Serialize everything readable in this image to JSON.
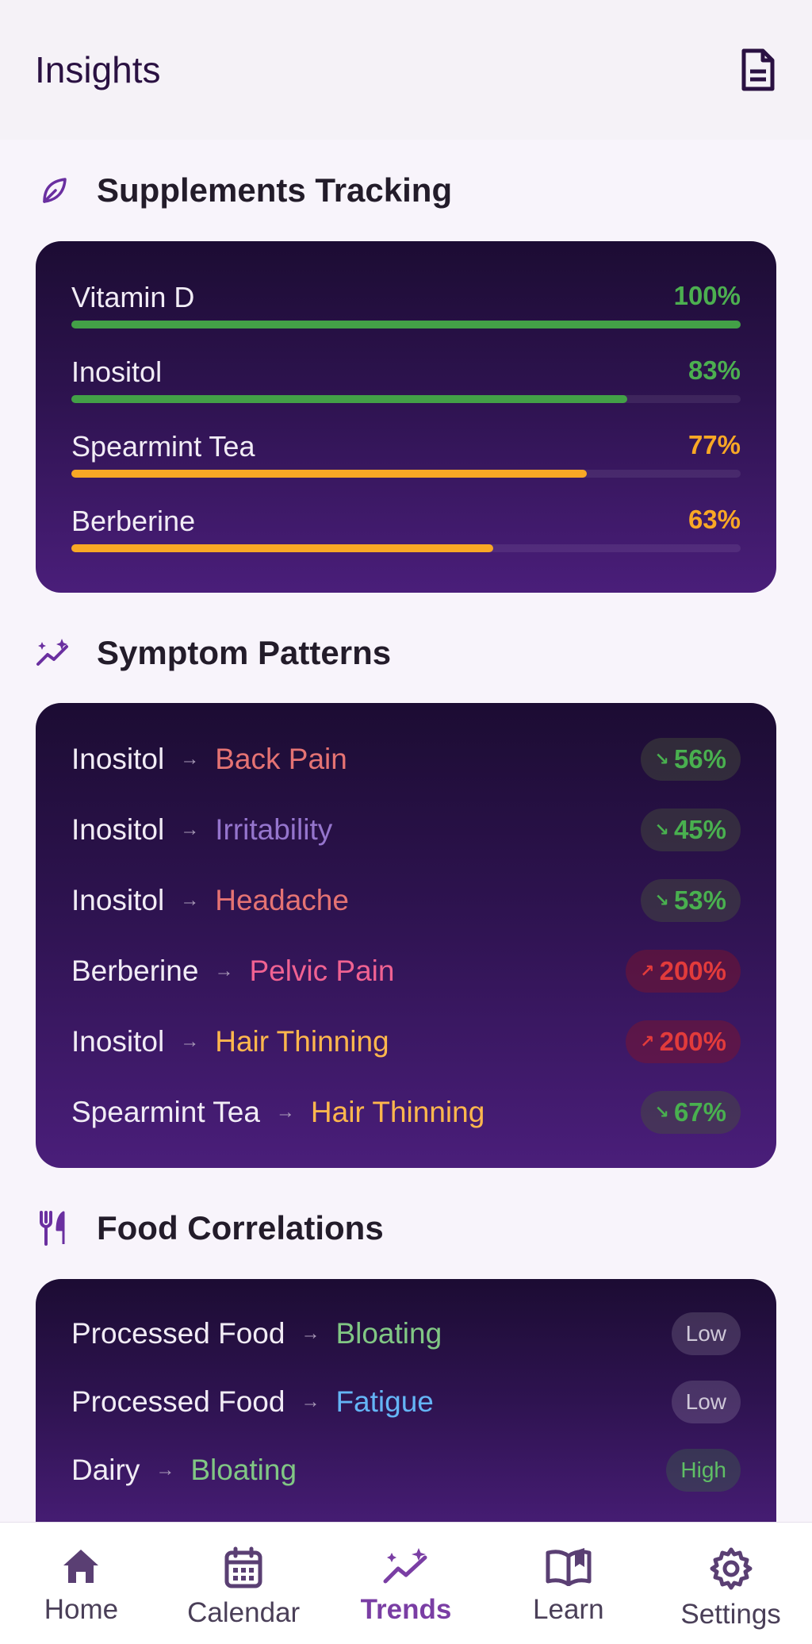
{
  "header": {
    "title": "Insights",
    "report_icon": "document-icon"
  },
  "colors": {
    "good": "#49b04f",
    "warn": "#f9a825",
    "bad": "#e23b3b",
    "accent": "#7a3ea4"
  },
  "supplements": {
    "title": "Supplements Tracking",
    "icon": "leaf-icon",
    "items": [
      {
        "name": "Vitamin D",
        "percent_label": "100%",
        "value": 100,
        "color": "#43a047"
      },
      {
        "name": "Inositol",
        "percent_label": "83%",
        "value": 83,
        "color": "#43a047"
      },
      {
        "name": "Spearmint Tea",
        "percent_label": "77%",
        "value": 77,
        "color": "#f9a825"
      },
      {
        "name": "Berberine",
        "percent_label": "63%",
        "value": 63,
        "color": "#f9a825"
      }
    ]
  },
  "patterns": {
    "title": "Symptom Patterns",
    "icon": "sparkle-trend-icon",
    "items": [
      {
        "supplement": "Inositol",
        "symptom": "Back Pain",
        "symptom_color": "#e57373",
        "change": "56%",
        "direction": "down"
      },
      {
        "supplement": "Inositol",
        "symptom": "Irritability",
        "symptom_color": "#9575cd",
        "change": "45%",
        "direction": "down"
      },
      {
        "supplement": "Inositol",
        "symptom": "Headache",
        "symptom_color": "#e57373",
        "change": "53%",
        "direction": "down"
      },
      {
        "supplement": "Berberine",
        "symptom": "Pelvic Pain",
        "symptom_color": "#f06292",
        "change": "200%",
        "direction": "up"
      },
      {
        "supplement": "Inositol",
        "symptom": "Hair Thinning",
        "symptom_color": "#ffb74d",
        "change": "200%",
        "direction": "up"
      },
      {
        "supplement": "Spearmint Tea",
        "symptom": "Hair Thinning",
        "symptom_color": "#ffb74d",
        "change": "67%",
        "direction": "down"
      }
    ]
  },
  "food": {
    "title": "Food Correlations",
    "icon": "fork-knife-icon",
    "items": [
      {
        "food": "Processed Food",
        "symptom": "Bloating",
        "symptom_color": "#81c784",
        "level": "Low",
        "level_type": "low"
      },
      {
        "food": "Processed Food",
        "symptom": "Fatigue",
        "symptom_color": "#64b5f6",
        "level": "Low",
        "level_type": "low"
      },
      {
        "food": "Dairy",
        "symptom": "Bloating",
        "symptom_color": "#81c784",
        "level": "High",
        "level_type": "high"
      }
    ]
  },
  "nav": {
    "items": [
      {
        "label": "Home",
        "icon": "home-icon",
        "active": false
      },
      {
        "label": "Calendar",
        "icon": "calendar-icon",
        "active": false
      },
      {
        "label": "Trends",
        "icon": "trends-icon",
        "active": true
      },
      {
        "label": "Learn",
        "icon": "book-icon",
        "active": false
      },
      {
        "label": "Settings",
        "icon": "gear-icon",
        "active": false
      }
    ]
  }
}
